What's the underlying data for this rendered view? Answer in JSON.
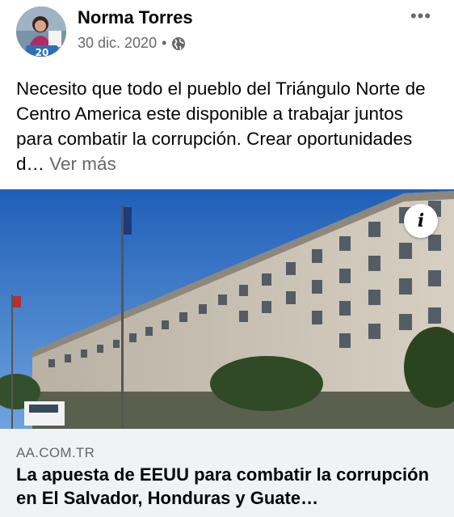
{
  "post": {
    "author": "Norma Torres",
    "avatar_badge": "20",
    "date": "30 dic. 2020",
    "separator": "•",
    "privacy_icon": "globe-icon",
    "more_icon": "more-options-icon",
    "more_label": "•••",
    "text": "Necesito que todo el pueblo del Triángulo Norte de Centro America este disponible a trabajar juntos para combatir la corrupción. Crear oportunidades d…",
    "see_more": "Ver más"
  },
  "link_preview": {
    "image_alt_icon": "info-icon",
    "info_label": "i",
    "domain": "AA.COM.TR",
    "title": "La apuesta de EEUU para combatir la corrupción en El Salvador, Honduras y Guate…"
  },
  "colors": {
    "text_primary": "#050505",
    "text_secondary": "#65676b",
    "card_background": "#f0f2f5"
  }
}
